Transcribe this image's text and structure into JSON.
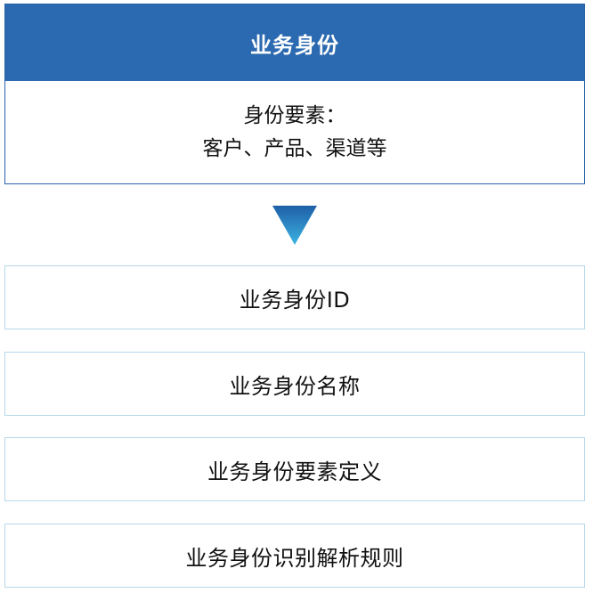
{
  "header": {
    "title": "业务身份"
  },
  "summary": {
    "line1": "身份要素：",
    "line2": "客户、产品、渠道等"
  },
  "items": [
    {
      "label": "业务身份ID"
    },
    {
      "label": "业务身份名称"
    },
    {
      "label": "业务身份要素定义"
    },
    {
      "label": "业务身份识别解析规则"
    }
  ],
  "colors": {
    "header_bg": "#2b6ab0",
    "header_text": "#ffffff",
    "arrow_top": "#1f5fa6",
    "arrow_bottom": "#3bb3e2",
    "item_border": "#b7d9ea"
  }
}
